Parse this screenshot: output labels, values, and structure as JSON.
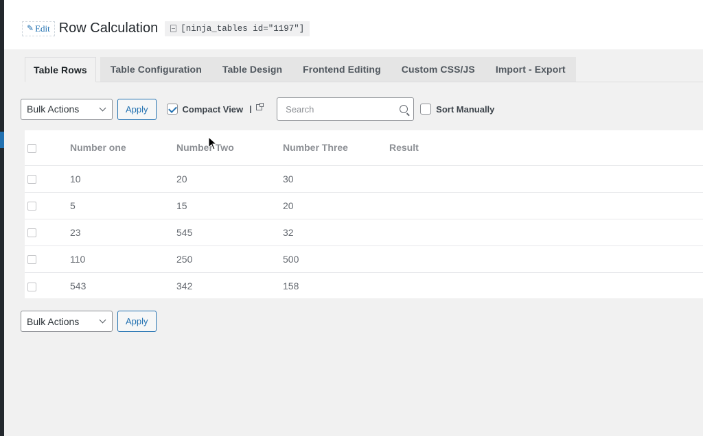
{
  "header": {
    "edit_label": "Edit",
    "title": "Row Calculation",
    "shortcode": "[ninja_tables id=\"1197\"]"
  },
  "tabs": [
    {
      "label": "Table Rows",
      "active": true
    },
    {
      "label": "Table Configuration",
      "active": false
    },
    {
      "label": "Table Design",
      "active": false
    },
    {
      "label": "Frontend Editing",
      "active": false
    },
    {
      "label": "Custom CSS/JS",
      "active": false
    },
    {
      "label": "Import - Export",
      "active": false
    }
  ],
  "toolbar_top": {
    "bulk_actions": "Bulk Actions",
    "apply": "Apply",
    "compact_view": {
      "label": "Compact View",
      "checked": true
    },
    "search": {
      "placeholder": "Search",
      "value": ""
    },
    "sort_manually": {
      "label": "Sort Manually",
      "checked": false
    }
  },
  "table": {
    "columns": [
      "Number one",
      "Number Two",
      "Number Three",
      "Result"
    ],
    "rows": [
      [
        "10",
        "20",
        "30",
        ""
      ],
      [
        "5",
        "15",
        "20",
        ""
      ],
      [
        "23",
        "545",
        "32",
        ""
      ],
      [
        "110",
        "250",
        "500",
        ""
      ],
      [
        "543",
        "342",
        "158",
        ""
      ]
    ]
  },
  "toolbar_bottom": {
    "bulk_actions": "Bulk Actions",
    "apply": "Apply"
  },
  "colors": {
    "accent": "#2271b1",
    "admin_sidebar": "#23282d",
    "content_background": "#f1f1f1"
  }
}
